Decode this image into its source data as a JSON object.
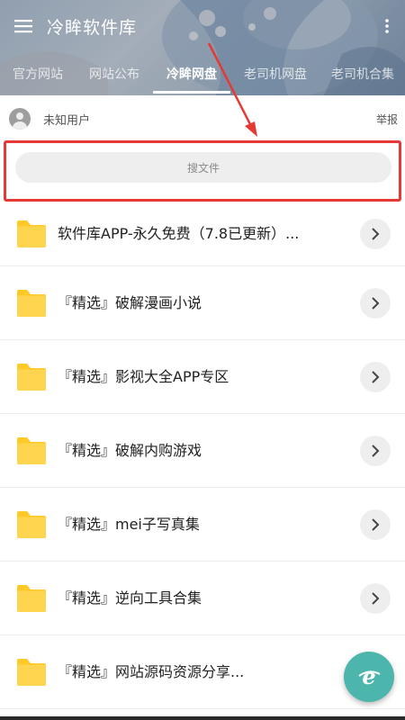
{
  "app": {
    "title": "冷眸软件库"
  },
  "tabs": [
    {
      "label": "官方网站"
    },
    {
      "label": "网站公布"
    },
    {
      "label": "冷眸网盘"
    },
    {
      "label": "老司机网盘"
    },
    {
      "label": "老司机合集"
    }
  ],
  "active_tab": "冷眸网盘",
  "user": {
    "name": "未知用户",
    "report": "举报"
  },
  "search": {
    "placeholder": "搜文件"
  },
  "items": [
    {
      "title": "软件库APP-永久免费（7.8已更新）..."
    },
    {
      "title": "『精选』破解漫画小说"
    },
    {
      "title": "『精选』影视大全APP专区"
    },
    {
      "title": "『精选』破解内购游戏"
    },
    {
      "title": "『精选』mei子写真集"
    },
    {
      "title": "『精选』逆向工具合集"
    },
    {
      "title": "『精选』网站源码资源分享..."
    }
  ],
  "icons": {
    "menu": "hamburger-menu-icon",
    "more": "more-vert-icon",
    "folder": "folder-icon",
    "chevron": "chevron-right-icon",
    "fab": "browser-e-icon"
  },
  "colors": {
    "folder": "#ffd54f",
    "folder_tab": "#ffca28",
    "highlight": "#e53935",
    "fab": "#4db6ac"
  }
}
